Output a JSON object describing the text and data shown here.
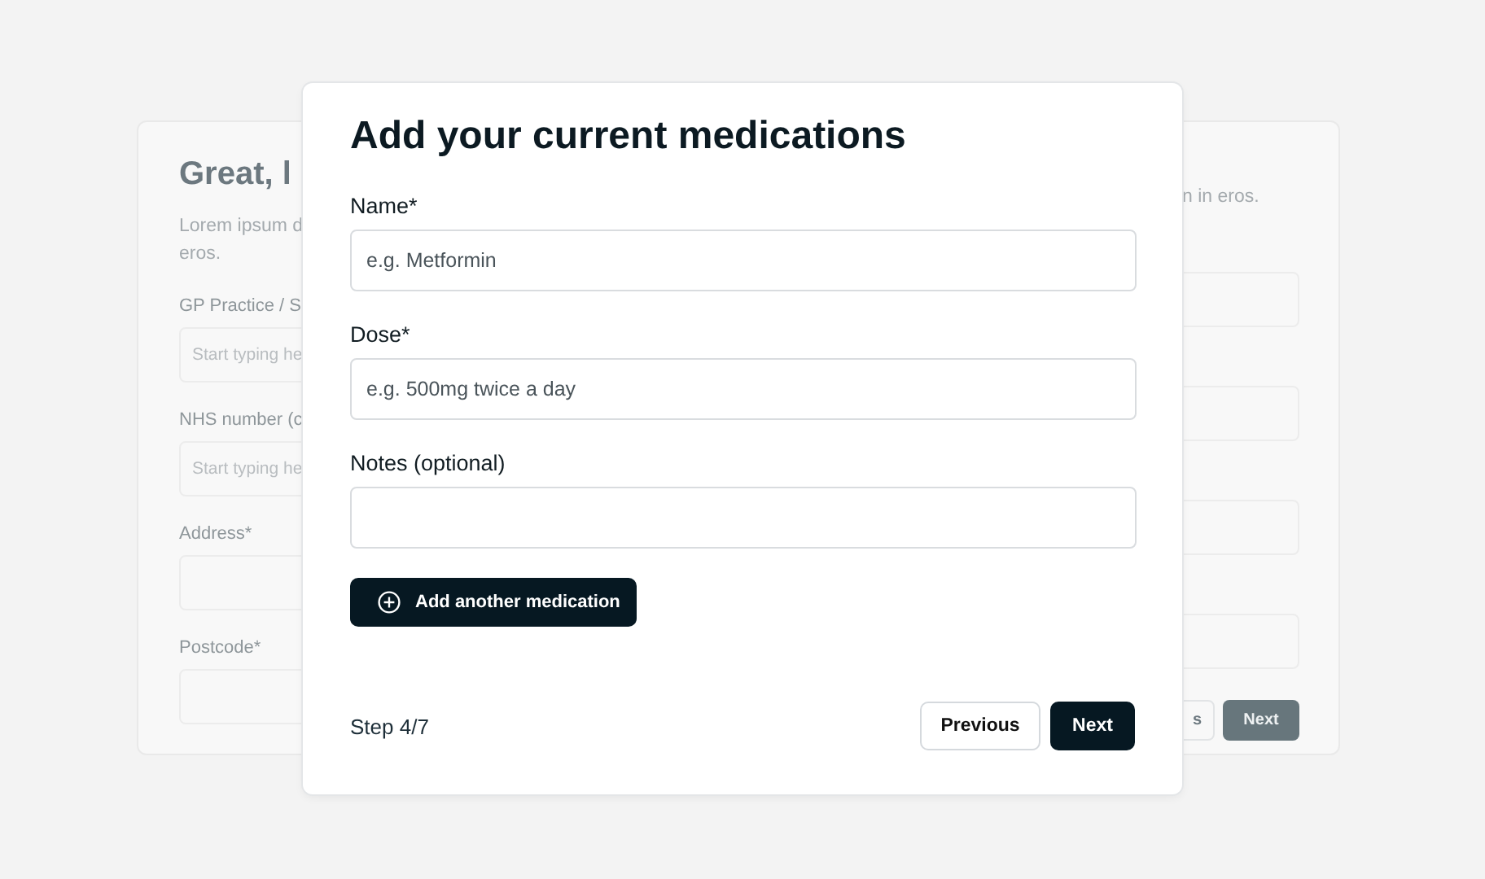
{
  "background_form": {
    "title": "Great, l",
    "description_lines": [
      "Lorem ipsum d",
      "eros."
    ],
    "description_right": "n in eros.",
    "fields": [
      {
        "label": "GP Practice / S",
        "placeholder": "Start typing he"
      },
      {
        "label": "NHS number (c",
        "placeholder": "Start typing he"
      },
      {
        "label": "Address*"
      },
      {
        "label": "Postcode*"
      }
    ],
    "buttons": [
      {
        "label": "s",
        "kind": "secondary"
      },
      {
        "label": "Next",
        "kind": "primary"
      }
    ]
  },
  "modal": {
    "title": "Add your current medications",
    "fields": [
      {
        "label": "Name*",
        "placeholder": "e.g. Metformin"
      },
      {
        "label": "Dose*",
        "placeholder": "e.g. 500mg twice a day"
      },
      {
        "label": "Notes (optional)"
      }
    ],
    "add_button": "Add another medication",
    "step": "Step 4/7",
    "buttons": [
      {
        "label": "Previous",
        "kind": "secondary"
      },
      {
        "label": "Next",
        "kind": "primary"
      }
    ]
  }
}
